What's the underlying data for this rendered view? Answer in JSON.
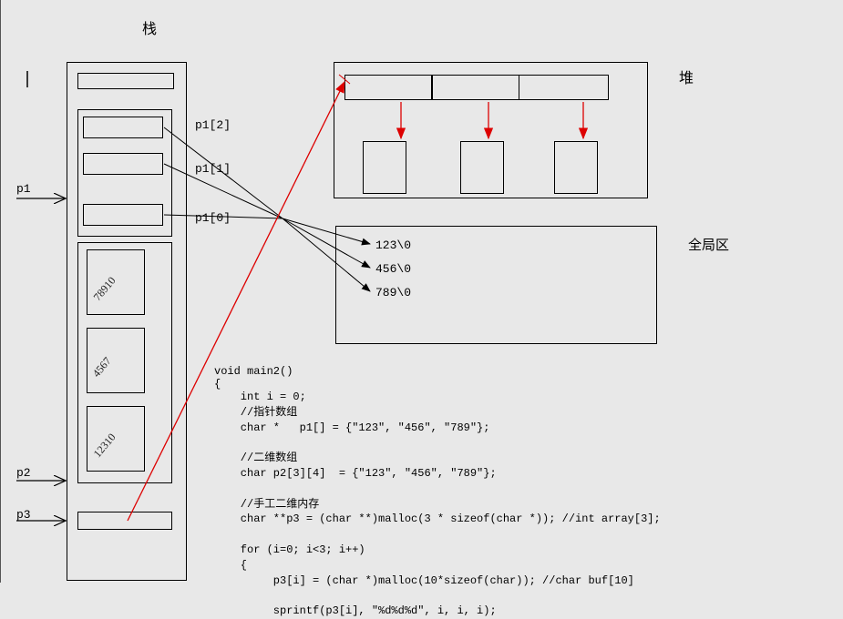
{
  "headings": {
    "stack": "栈",
    "heap": "堆",
    "global": "全局区"
  },
  "pointerLabels": {
    "p1": "p1",
    "p2": "p2",
    "p3": "p3",
    "p1_0": "p1[0]",
    "p1_1": "p1[1]",
    "p1_2": "p1[2]"
  },
  "globalStrings": {
    "s0": "123\\0",
    "s1": "456\\0",
    "s2": "789\\0"
  },
  "scribbles": {
    "a": "78910",
    "b": "4567",
    "c": "12310"
  },
  "code": {
    "signature": "void main2()",
    "body": "    int i = 0;\n    //指针数组\n    char *   p1[] = {\"123\", \"456\", \"789\"};\n\n    //二维数组\n    char p2[3][4]  = {\"123\", \"456\", \"789\"};\n\n    //手工二维内存\n    char **p3 = (char **)malloc(3 * sizeof(char *)); //int array[3];\n\n    for (i=0; i<3; i++)\n    {\n         p3[i] = (char *)malloc(10*sizeof(char)); //char buf[10]\n\n         sprintf(p3[i], \"%d%d%d\", i, i, i);"
  }
}
